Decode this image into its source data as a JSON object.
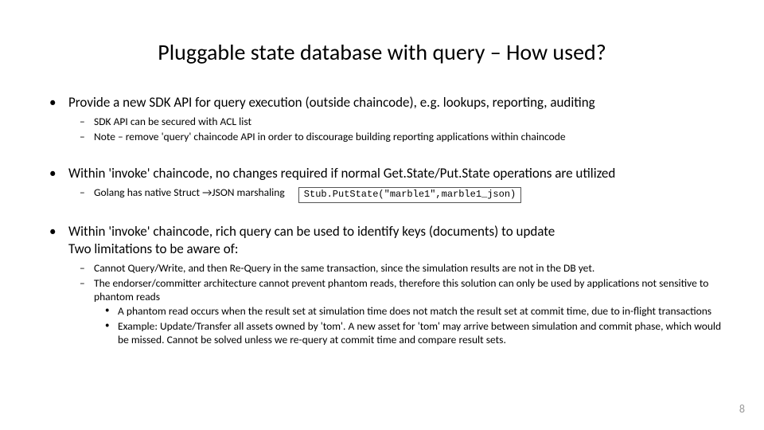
{
  "title": "Pluggable state database with query – How used?",
  "bullets": [
    {
      "text": "Provide a new SDK API for query execution (outside chaincode), e.g. lookups, reporting, auditing",
      "sub": [
        {
          "text": "SDK API can be secured with ACL list"
        },
        {
          "text": "Note – remove 'query' chaincode API in order to discourage building reporting applications within chaincode"
        }
      ]
    },
    {
      "text": "Within 'invoke' chaincode, no changes required if normal Get.State/Put.State operations are utilized",
      "sub": [
        {
          "text": "Golang has native Struct →JSON marshaling",
          "code": "Stub.PutState(\"marble1\",marble1_json)"
        }
      ]
    },
    {
      "text": "Within 'invoke' chaincode, rich query can be used to identify keys (documents) to update",
      "text2": "Two limitations to be aware of:",
      "sub": [
        {
          "text": "Cannot Query/Write, and then Re-Query in the same transaction, since the simulation results are not in the DB yet."
        },
        {
          "text": "The endorser/committer architecture cannot prevent phantom reads, therefore this solution can only be used by applications not sensitive to phantom reads",
          "sub": [
            {
              "text": "A phantom read occurs when the result set at simulation time does not match the result set at commit time, due to in-flight transactions"
            },
            {
              "text": "Example: Update/Transfer all assets owned by 'tom'. A new asset for 'tom' may arrive between simulation and commit phase, which would be missed. Cannot be solved unless we re-query at commit time and compare result sets."
            }
          ]
        }
      ]
    }
  ],
  "page_number": "8"
}
